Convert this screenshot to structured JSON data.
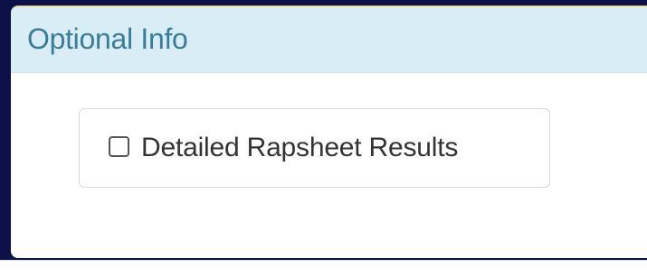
{
  "panel": {
    "title": "Optional Info"
  },
  "options": {
    "detailed_rapsheet": {
      "label": "Detailed Rapsheet Results",
      "checked": false
    }
  },
  "colors": {
    "backdrop": "#0c1248",
    "heading_bg": "#d9edf7",
    "heading_text": "#3a7d9a",
    "body_text": "#333333"
  }
}
